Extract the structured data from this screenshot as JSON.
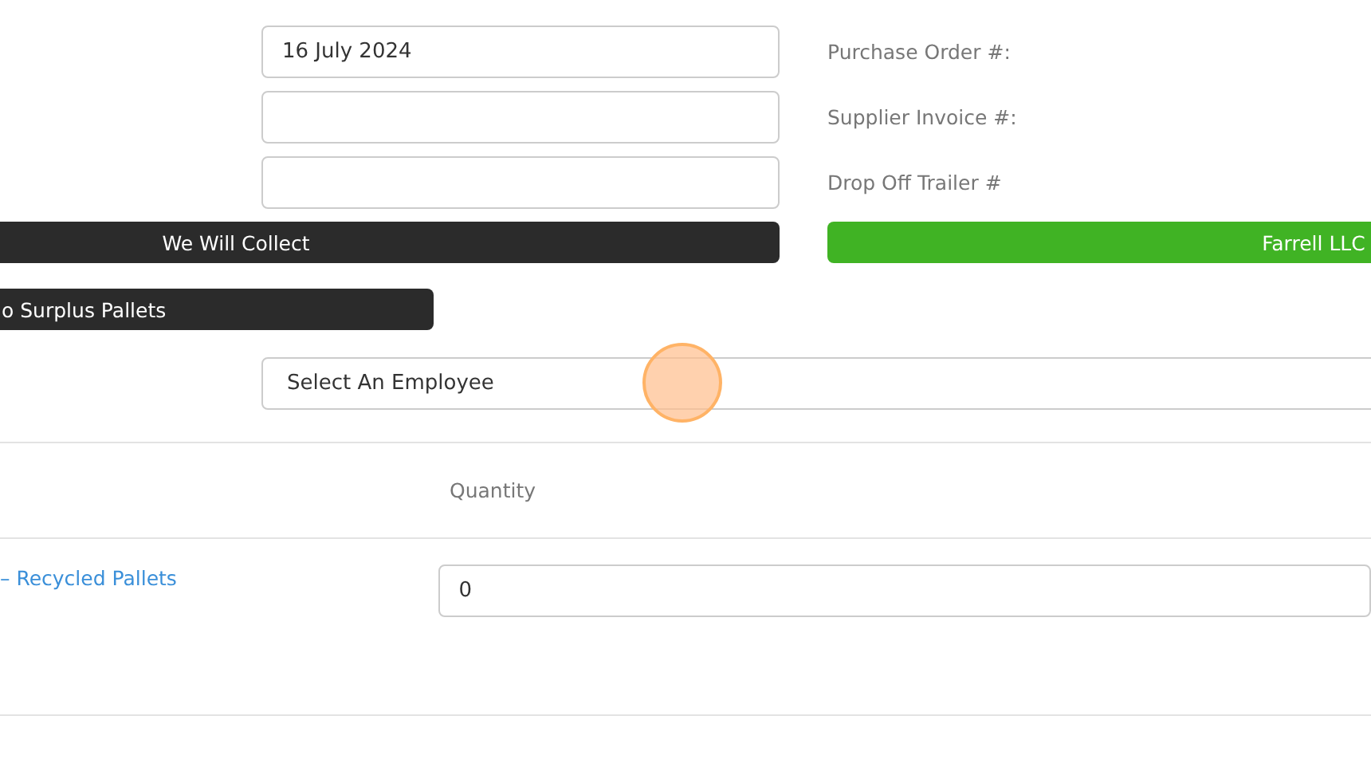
{
  "reference_rows": [
    {
      "value": "16 July 2024",
      "label": "Purchase Order #:"
    },
    {
      "label": "Supplier Invoice #:"
    },
    {
      "label": "Drop Off Trailer #"
    }
  ],
  "collect_button": {
    "label": "We Will Collect"
  },
  "supplier_button": {
    "label": "Farrell LLC"
  },
  "surplus_button": {
    "label": "o Surplus Pallets"
  },
  "employee_select": {
    "placeholder": "Select An Employee"
  },
  "table": {
    "columns": [
      "Quantity"
    ],
    "rows": [
      {
        "item": "– Recycled Pallets",
        "quantity": "0"
      }
    ]
  }
}
